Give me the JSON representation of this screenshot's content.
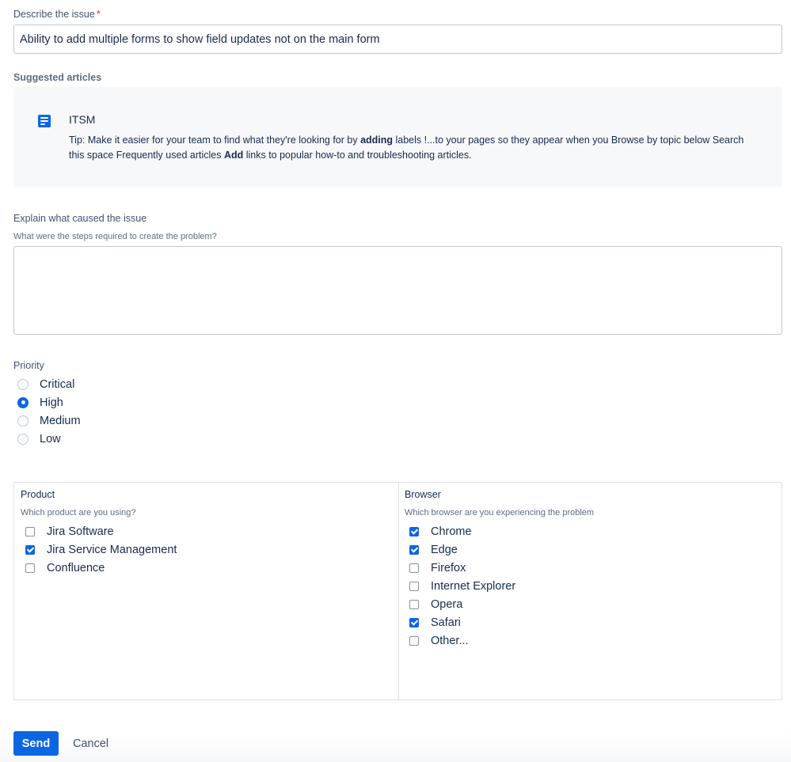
{
  "describe": {
    "label": "Describe the issue",
    "required_mark": "*",
    "value": "Ability to add multiple forms to show field updates not on the main form"
  },
  "suggested": {
    "heading": "Suggested articles",
    "article": {
      "icon": "document-icon",
      "title": "ITSM",
      "excerpt_parts": [
        "Tip: Make it easier for your team to find what they're looking for by ",
        "adding",
        " labels !...to your pages so they appear when you  Browse by topic below Search this space Frequently used articles ",
        "Add",
        " links to popular how-to and troubleshooting articles."
      ]
    }
  },
  "explain": {
    "label": "Explain what caused the issue",
    "helper": "What were the steps required to create the problem?",
    "value": ""
  },
  "priority": {
    "label": "Priority",
    "options": [
      "Critical",
      "High",
      "Medium",
      "Low"
    ],
    "selected": "High"
  },
  "product": {
    "label": "Product",
    "helper": "Which product are you using?",
    "options": [
      {
        "label": "Jira Software",
        "checked": false
      },
      {
        "label": "Jira Service Management",
        "checked": true
      },
      {
        "label": "Confluence",
        "checked": false
      }
    ]
  },
  "browser": {
    "label": "Browser",
    "helper": "Which browser are you experiencing the problem",
    "options": [
      {
        "label": "Chrome",
        "checked": true
      },
      {
        "label": "Edge",
        "checked": true
      },
      {
        "label": "Firefox",
        "checked": false
      },
      {
        "label": "Internet Explorer",
        "checked": false
      },
      {
        "label": "Opera",
        "checked": false
      },
      {
        "label": "Safari",
        "checked": true
      },
      {
        "label": "Other...",
        "checked": false
      }
    ]
  },
  "actions": {
    "send_label": "Send",
    "cancel_label": "Cancel"
  },
  "colors": {
    "accent": "#0c66e4",
    "text": "#172b4d",
    "required": "#de350b"
  }
}
